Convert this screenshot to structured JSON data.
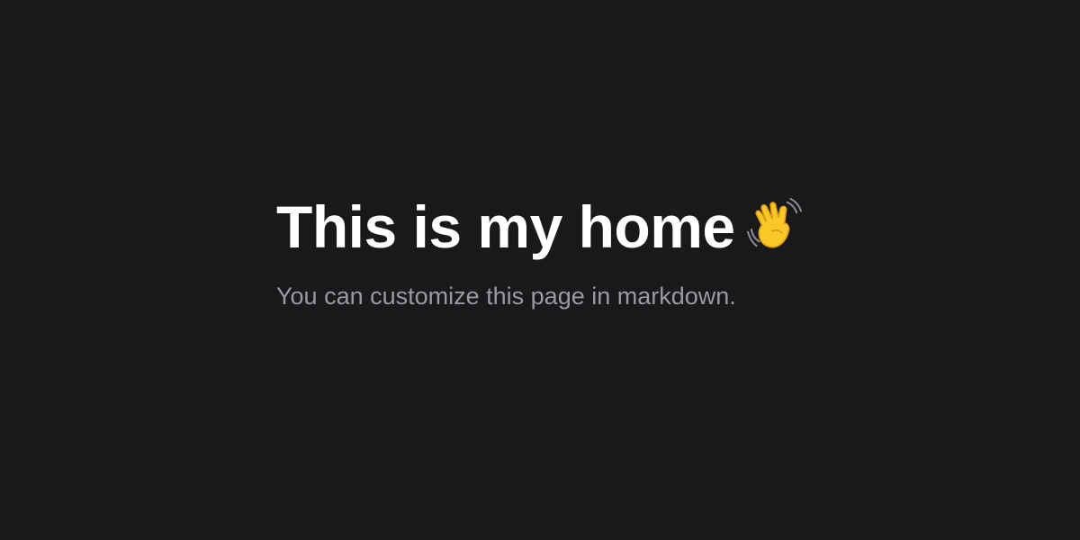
{
  "hero": {
    "title": "This is my home",
    "subtitle": "You can customize this page in markdown.",
    "icon": "waving-hand-icon"
  },
  "colors": {
    "background": "#19191b",
    "title": "#ffffff",
    "subtitle": "#9a9aa0",
    "emoji": "#f9c828"
  }
}
